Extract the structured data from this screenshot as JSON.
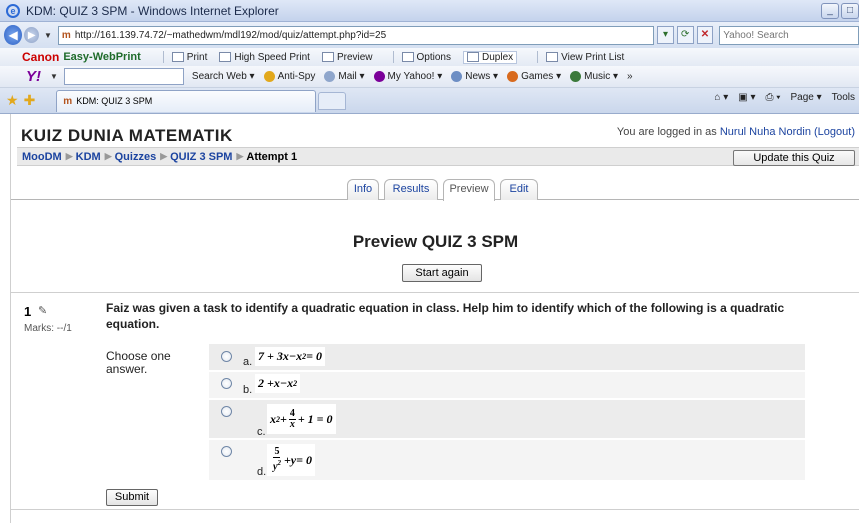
{
  "window": {
    "title": "KDM: QUIZ 3 SPM - Windows Internet Explorer",
    "ie_logo": "e"
  },
  "address_bar": {
    "url": "http://161.139.74.72/~mathedwm/mdl192/mod/quiz/attempt.php?id=25",
    "favicon": "m",
    "search_placeholder": "Yahoo! Search"
  },
  "canon_toolbar": {
    "brand": "Canon",
    "product": "Easy-WebPrint",
    "items": [
      "Print",
      "High Speed Print",
      "Preview",
      "Options",
      "Duplex",
      "View Print List"
    ]
  },
  "yahoo_toolbar": {
    "logo": "Y!",
    "items": [
      "Search Web",
      "Anti-Spy",
      "Mail",
      "My Yahoo!",
      "News",
      "Games",
      "Music"
    ],
    "more": "»"
  },
  "browser_tab": {
    "label": "KDM: QUIZ 3 SPM",
    "favicon": "m"
  },
  "command_bar": {
    "items": [
      "Page",
      "Tools"
    ]
  },
  "colors": {
    "link": "#1c44a0",
    "radio_border": "#6f86a6",
    "option_shade": "#ececec"
  },
  "site": {
    "title": "KUIZ DUNIA MATEMATIK",
    "login_prefix": "You are logged in as",
    "user": "Nurul Nuha Nordin",
    "logout": "(Logout)"
  },
  "breadcrumb": {
    "items": [
      "MooDM",
      "KDM",
      "Quizzes",
      "QUIZ 3 SPM"
    ],
    "current": "Attempt 1"
  },
  "update_button": "Update this Quiz",
  "tabs": [
    "Info",
    "Results",
    "Preview",
    "Edit"
  ],
  "preview": {
    "heading": "Preview QUIZ 3 SPM",
    "start_again": "Start again"
  },
  "question": {
    "number": "1",
    "marks": "Marks: --/1",
    "text": "Faiz was given a task to identify a quadratic equation in class. Help him to identify which of the following is a quadratic equation.",
    "prompt": "Choose one answer.",
    "options": [
      {
        "letter": "a.",
        "parts": [
          "7 + 3",
          "x",
          " − ",
          "x",
          "2",
          " = 0"
        ]
      },
      {
        "letter": "b.",
        "parts": [
          "2 + ",
          "x",
          " − ",
          "x",
          "2"
        ]
      },
      {
        "letter": "c.",
        "parts": [
          "x",
          "2",
          " + ",
          "4",
          "x",
          " + 1 = 0"
        ]
      },
      {
        "letter": "d.",
        "parts": [
          "5",
          "y",
          "2",
          " + ",
          "y",
          " = 0"
        ]
      }
    ],
    "submit": "Submit"
  }
}
